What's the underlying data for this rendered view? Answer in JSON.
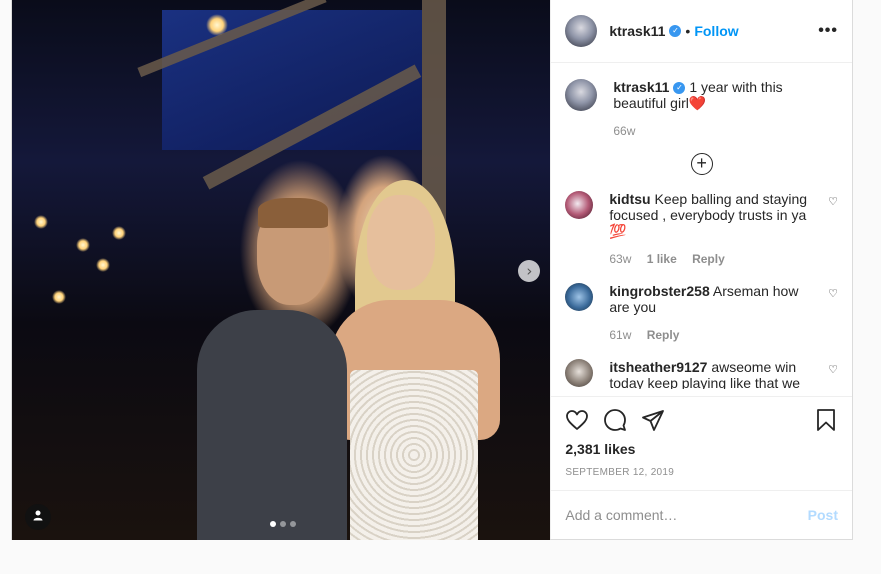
{
  "header": {
    "username": "ktrask11",
    "dot": "•",
    "follow_label": "Follow",
    "more_label": "•••"
  },
  "caption": {
    "username": "ktrask11",
    "text": "1 year with this beautiful girl❤️",
    "time": "66w"
  },
  "comments": [
    {
      "username": "kidtsu",
      "text": "Keep balling and staying focused , everybody trusts in ya 💯",
      "time": "63w",
      "likes": "1 like",
      "reply": "Reply"
    },
    {
      "username": "kingrobster258",
      "text": "Arseman how are you",
      "time": "61w",
      "reply": "Reply"
    },
    {
      "username": "itsheather9127",
      "text": "awseome win today keep playing like that we will"
    }
  ],
  "actions": {
    "likes": "2,381 likes",
    "date": "SEPTEMBER 12, 2019"
  },
  "add_comment": {
    "placeholder": "Add a comment…",
    "post_label": "Post"
  },
  "icons": {
    "like": "heart-icon",
    "comment": "comment-icon",
    "share": "share-icon",
    "save": "bookmark-icon",
    "next": "chevron-right-icon",
    "tag": "user-tag-icon",
    "load_more": "plus-circle-icon"
  },
  "colors": {
    "follow": "#0095f6",
    "verified": "#3897f0",
    "post_disabled": "#b3dbff"
  }
}
